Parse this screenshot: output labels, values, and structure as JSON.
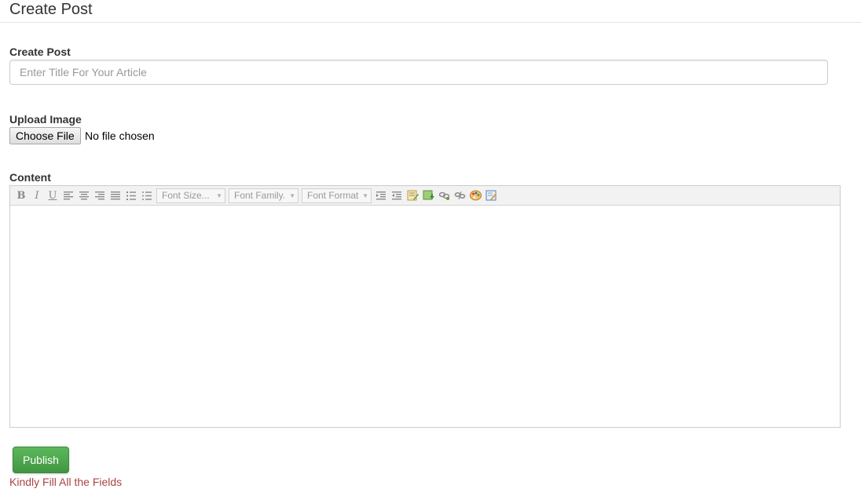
{
  "page": {
    "title": "Create Post"
  },
  "form": {
    "title_label": "Create Post",
    "title_placeholder": "Enter Title For Your Article",
    "title_value": "",
    "upload_label": "Upload Image",
    "choose_file_label": "Choose File",
    "file_status": "No file chosen",
    "content_label": "Content"
  },
  "editor": {
    "font_size_label": "Font Size...",
    "font_family_label": "Font Family.",
    "font_format_label": "Font Format",
    "content": ""
  },
  "actions": {
    "publish_label": "Publish"
  },
  "status": {
    "message": "Kindly Fill All the Fields"
  },
  "colors": {
    "publish_green": "#5cb85c",
    "error_text": "#a94442",
    "border": "#cccccc"
  }
}
